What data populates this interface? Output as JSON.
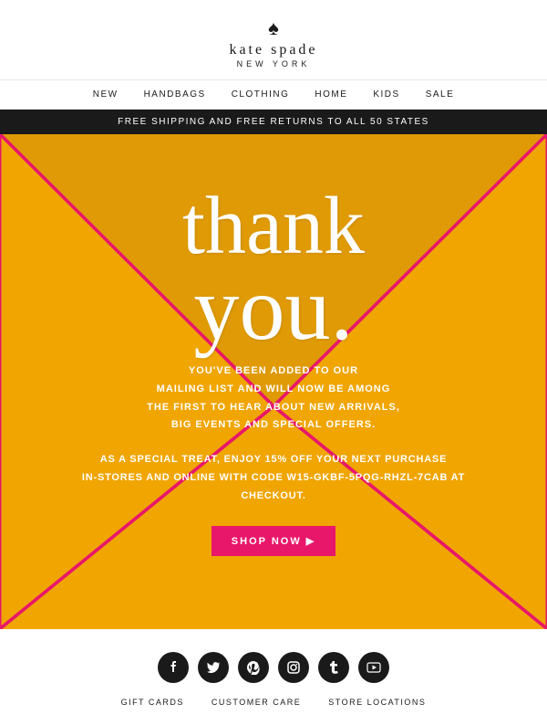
{
  "header": {
    "spade_symbol": "♠",
    "brand_name": "kate spade",
    "location": "NEW YORK"
  },
  "nav": {
    "items": [
      {
        "label": "NEW"
      },
      {
        "label": "HANDBAGS"
      },
      {
        "label": "CLOTHING"
      },
      {
        "label": "HOME"
      },
      {
        "label": "KIDS"
      },
      {
        "label": "SALE"
      }
    ]
  },
  "banner": {
    "text": "FREE SHIPPING AND FREE RETURNS TO ALL 50 STATES"
  },
  "envelope": {
    "thank_you_line1": "thank",
    "thank_you_line2": "you.",
    "message1": "YOU'VE BEEN ADDED TO OUR\nMAILING LIST AND WILL NOW BE AMONG\nTHE FIRST TO HEAR ABOUT NEW ARRIVALS,\nBIG EVENTS AND SPECIAL OFFERS.",
    "message2": "AS A SPECIAL TREAT, ENJOY 15% OFF YOUR NEXT PURCHASE\nIN-STORES AND ONLINE WITH CODE W15-GKBF-5PQG-RHZL-7CAB AT\nCHECKOUT.",
    "cta_label": "SHOP NOW",
    "cta_arrow": "▶"
  },
  "footer": {
    "social": [
      {
        "name": "facebook",
        "icon": "f"
      },
      {
        "name": "twitter",
        "icon": "t"
      },
      {
        "name": "pinterest",
        "icon": "p"
      },
      {
        "name": "instagram",
        "icon": "◉"
      },
      {
        "name": "tumblr",
        "icon": "T"
      },
      {
        "name": "youtube",
        "icon": "▶"
      }
    ],
    "links": [
      {
        "label": "GIFT CARDS"
      },
      {
        "label": "CUSTOMER CARE"
      },
      {
        "label": "STORE LOCATIONS"
      }
    ]
  }
}
